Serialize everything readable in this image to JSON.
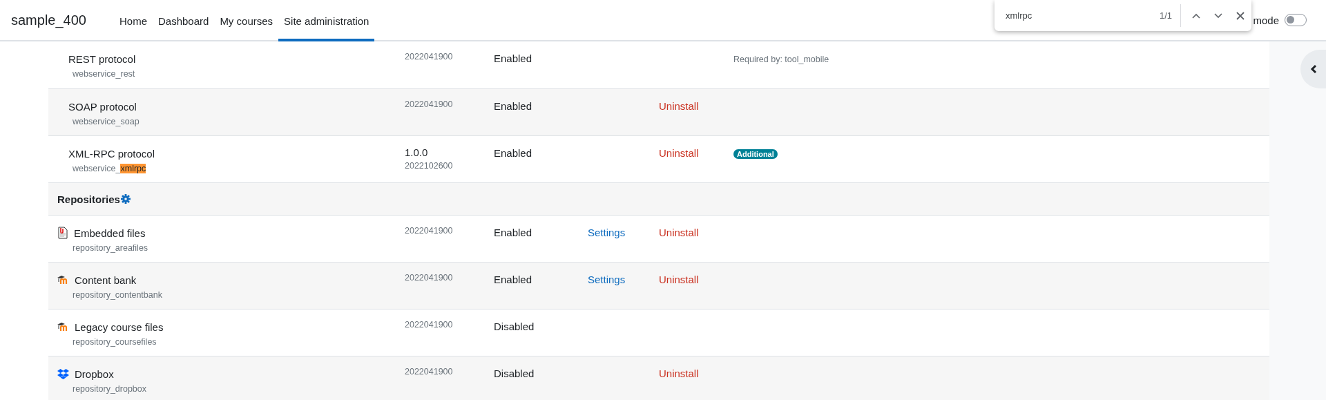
{
  "navbar": {
    "brand": "sample_400",
    "items": [
      {
        "label": "Home",
        "selected": false
      },
      {
        "label": "Dashboard",
        "selected": false
      },
      {
        "label": "My courses",
        "selected": false
      },
      {
        "label": "Site administration",
        "selected": true
      }
    ],
    "edit_mode": {
      "label": "mode",
      "on": false
    }
  },
  "find_bar": {
    "value": "xmlrpc",
    "count": "1/1"
  },
  "rows": [
    {
      "kind": "plugin",
      "name": "REST protocol",
      "component": [
        {
          "text": "webservice_rest",
          "highlighted": false
        }
      ],
      "version": "2022041900",
      "status": "Enabled",
      "note": "Required by: tool_mobile"
    },
    {
      "kind": "plugin",
      "name": "SOAP protocol",
      "component": [
        {
          "text": "webservice_soap",
          "highlighted": false
        }
      ],
      "version": "2022041900",
      "status": "Enabled",
      "uninstall": "Uninstall"
    },
    {
      "kind": "plugin",
      "name": "XML-RPC protocol",
      "component": [
        {
          "text": "webservice_",
          "highlighted": false
        },
        {
          "text": "xmlrpc",
          "highlighted": true
        }
      ],
      "release": "1.0.0",
      "version": "2022102600",
      "status": "Enabled",
      "uninstall": "Uninstall",
      "badge": "Additional"
    },
    {
      "kind": "section",
      "name": "Repositories"
    },
    {
      "kind": "plugin",
      "name": "Embedded files",
      "component": [
        {
          "text": "repository_areafiles",
          "highlighted": false
        }
      ],
      "version": "2022041900",
      "status": "Enabled",
      "settings": "Settings",
      "uninstall": "Uninstall"
    },
    {
      "kind": "plugin",
      "name": "Content bank",
      "component": [
        {
          "text": "repository_contentbank",
          "highlighted": false
        }
      ],
      "version": "2022041900",
      "status": "Enabled",
      "settings": "Settings",
      "uninstall": "Uninstall"
    },
    {
      "kind": "plugin",
      "name": "Legacy course files",
      "component": [
        {
          "text": "repository_coursefiles",
          "highlighted": false
        }
      ],
      "version": "2022041900",
      "status": "Disabled"
    },
    {
      "kind": "plugin",
      "name": "Dropbox",
      "component": [
        {
          "text": "repository_dropbox",
          "highlighted": false
        }
      ],
      "version": "2022041900",
      "status": "Disabled",
      "uninstall": "Uninstall"
    }
  ]
}
